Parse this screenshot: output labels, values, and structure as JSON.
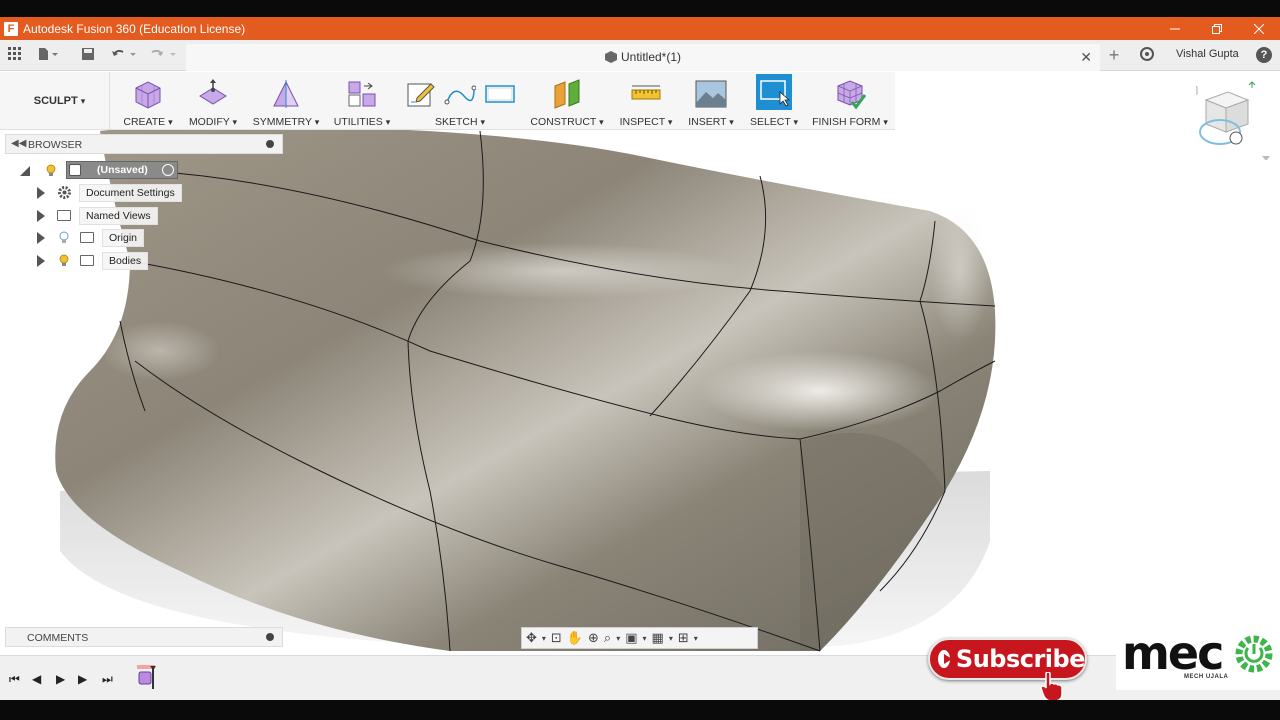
{
  "window": {
    "title": "Autodesk Fusion 360 (Education License)",
    "app_icon": "F"
  },
  "document": {
    "tab_title": "Untitled*(1)",
    "user": "Vishal Gupta",
    "help": "?"
  },
  "toolbar": {
    "workspace": "SCULPT",
    "groups": [
      {
        "label": "CREATE",
        "icon": "box-cube-icon"
      },
      {
        "label": "MODIFY",
        "icon": "edit-form-icon"
      },
      {
        "label": "SYMMETRY",
        "icon": "symmetry-icon"
      },
      {
        "label": "UTILITIES",
        "icon": "utilities-icon"
      },
      {
        "label": "SKETCH",
        "icon": "sketch-icon"
      },
      {
        "label": "CONSTRUCT",
        "icon": "plane-icon"
      },
      {
        "label": "INSPECT",
        "icon": "measure-icon"
      },
      {
        "label": "INSERT",
        "icon": "image-icon"
      },
      {
        "label": "SELECT",
        "icon": "select-window-icon"
      },
      {
        "label": "FINISH FORM",
        "icon": "finish-form-icon"
      }
    ],
    "dropdown_marker": "▾"
  },
  "browser": {
    "header": "BROWSER",
    "items": [
      {
        "label": "(Unsaved)",
        "level": 0
      },
      {
        "label": "Document Settings",
        "level": 1
      },
      {
        "label": "Named Views",
        "level": 1
      },
      {
        "label": "Origin",
        "level": 1
      },
      {
        "label": "Bodies",
        "level": 1
      }
    ]
  },
  "comments": {
    "header": "COMMENTS"
  },
  "overlay": {
    "subscribe": "Subscribe",
    "brand": "mec",
    "brand_sub": "MECH UJALA"
  },
  "colors": {
    "titlebar": "#e35b1e",
    "select_active": "#1e8fd0",
    "subscribe": "#c7161d"
  }
}
